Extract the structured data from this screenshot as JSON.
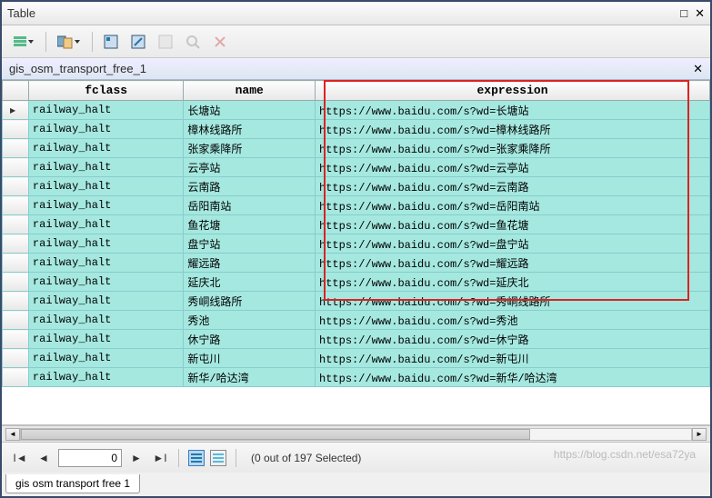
{
  "window": {
    "title": "Table"
  },
  "layer": {
    "name": "gis_osm_transport_free_1"
  },
  "columns": {
    "col1": "fclass",
    "col2": "name",
    "col3": "expression"
  },
  "rows": [
    {
      "fclass": "railway_halt",
      "name": "长塘站",
      "expr": "https://www.baidu.com/s?wd=长塘站"
    },
    {
      "fclass": "railway_halt",
      "name": "樟林线路所",
      "expr": "https://www.baidu.com/s?wd=樟林线路所"
    },
    {
      "fclass": "railway_halt",
      "name": "张家乘降所",
      "expr": "https://www.baidu.com/s?wd=张家乘降所"
    },
    {
      "fclass": "railway_halt",
      "name": "云亭站",
      "expr": "https://www.baidu.com/s?wd=云亭站"
    },
    {
      "fclass": "railway_halt",
      "name": "云南路",
      "expr": "https://www.baidu.com/s?wd=云南路"
    },
    {
      "fclass": "railway_halt",
      "name": "岳阳南站",
      "expr": "https://www.baidu.com/s?wd=岳阳南站"
    },
    {
      "fclass": "railway_halt",
      "name": "鱼花塘",
      "expr": "https://www.baidu.com/s?wd=鱼花塘"
    },
    {
      "fclass": "railway_halt",
      "name": "盘宁站",
      "expr": "https://www.baidu.com/s?wd=盘宁站"
    },
    {
      "fclass": "railway_halt",
      "name": "耀远路",
      "expr": "https://www.baidu.com/s?wd=耀远路"
    },
    {
      "fclass": "railway_halt",
      "name": "延庆北",
      "expr": "https://www.baidu.com/s?wd=延庆北"
    },
    {
      "fclass": "railway_halt",
      "name": "秀峒线路所",
      "expr": "https://www.baidu.com/s?wd=秀峒线路所"
    },
    {
      "fclass": "railway_halt",
      "name": "秀池",
      "expr": "https://www.baidu.com/s?wd=秀池"
    },
    {
      "fclass": "railway_halt",
      "name": "休宁路",
      "expr": "https://www.baidu.com/s?wd=休宁路"
    },
    {
      "fclass": "railway_halt",
      "name": "新屯川",
      "expr": "https://www.baidu.com/s?wd=新屯川"
    },
    {
      "fclass": "railway_halt",
      "name": "新华/哈达湾",
      "expr": "https://www.baidu.com/s?wd=新华/哈达湾"
    }
  ],
  "nav": {
    "pos": "0",
    "status": "(0 out of 197 Selected)"
  },
  "tab": {
    "label": "gis osm transport free 1"
  },
  "watermark": "https://blog.csdn.net/esa72ya"
}
